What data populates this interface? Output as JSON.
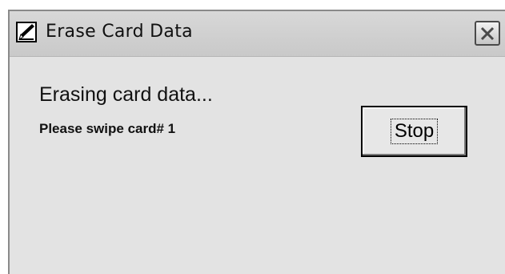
{
  "window": {
    "title": "Erase Card Data",
    "app_icon": "erase-card-app-icon",
    "close_icon": "close-icon"
  },
  "body": {
    "heading": "Erasing card data...",
    "instruction": "Please swipe card# 1"
  },
  "buttons": {
    "stop_label": "Stop"
  },
  "colors": {
    "window_background": "#e3e3e3",
    "titlebar": "#cfcfcf",
    "text": "#111111"
  }
}
